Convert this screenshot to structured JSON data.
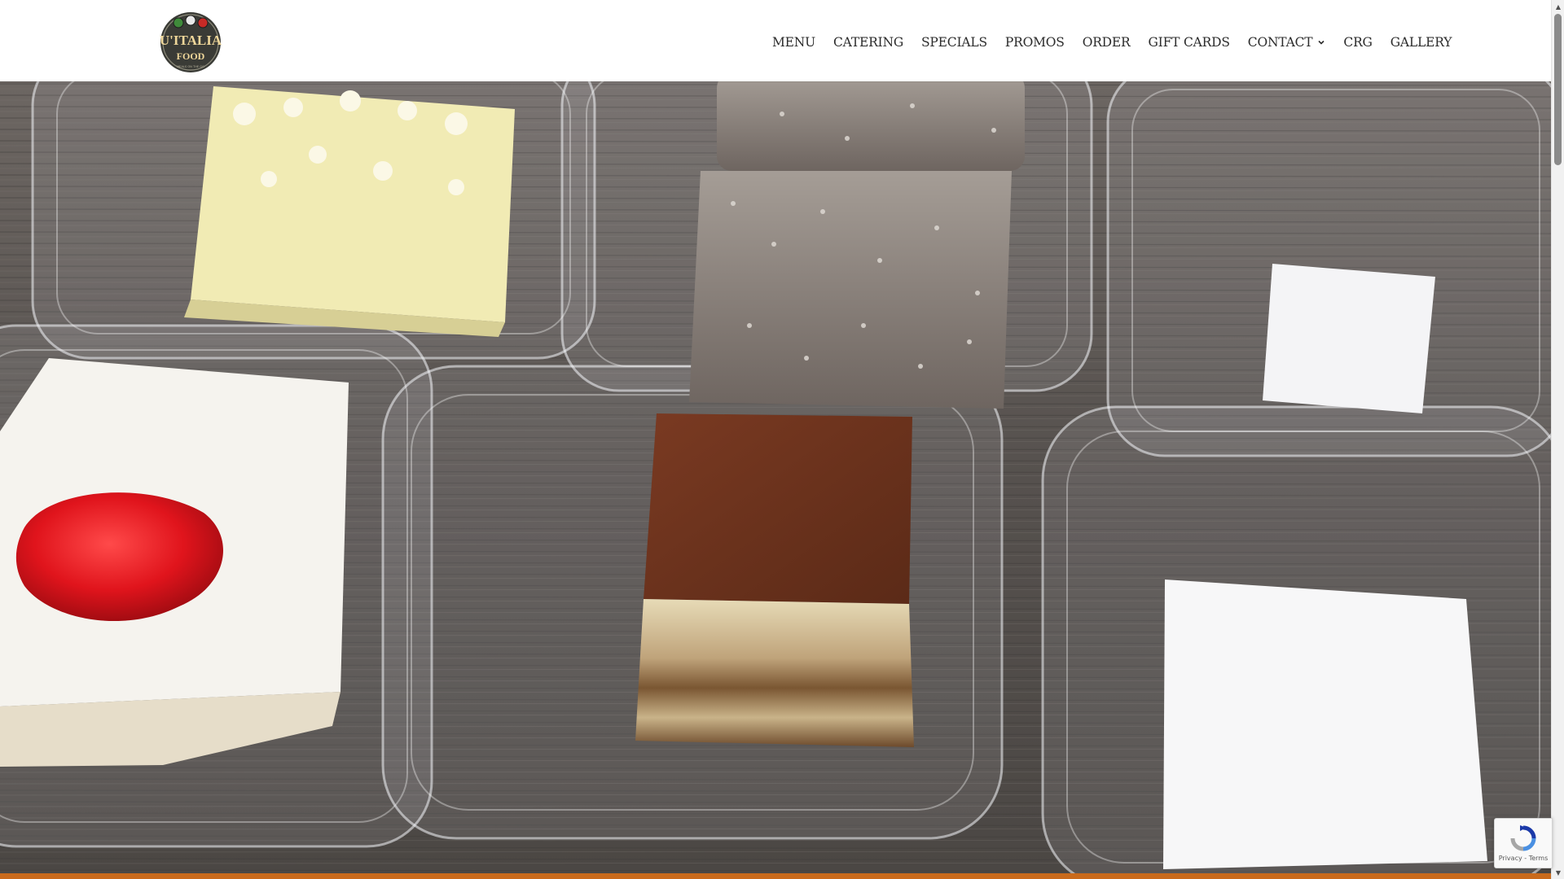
{
  "brand": {
    "logo_line1": "U'ITALIA",
    "logo_line2": "FOOD",
    "logo_tagline": "MEALS ON THE GO"
  },
  "nav": {
    "items": [
      {
        "label": "MENU"
      },
      {
        "label": "CATERING"
      },
      {
        "label": "SPECIALS"
      },
      {
        "label": "PROMOS"
      },
      {
        "label": "ORDER"
      },
      {
        "label": "GIFT CARDS"
      },
      {
        "label": "CONTACT",
        "has_dropdown": true
      },
      {
        "label": "CRG"
      },
      {
        "label": "GALLERY"
      }
    ]
  },
  "recaptcha": {
    "privacy_label": "Privacy",
    "separator": " - ",
    "terms_label": "Terms"
  },
  "scrollbar": {
    "up_arrow": "▲",
    "down_arrow": "▼"
  },
  "colors": {
    "accent": "#c96a1c",
    "nav_text": "#2b2b2b",
    "header_bg": "#ffffff"
  },
  "icons": {
    "logo": "uitalia-logo",
    "dropdown": "chevron-down-icon",
    "recaptcha": "recaptcha-icon"
  }
}
